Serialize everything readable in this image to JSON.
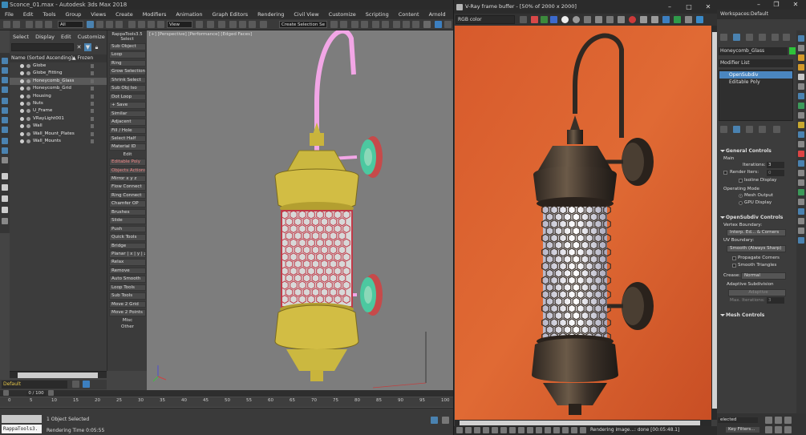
{
  "window": {
    "title": "Sconce_01.max - Autodesk 3ds Max 2018"
  },
  "menu": [
    "File",
    "Edit",
    "Tools",
    "Group",
    "Views",
    "Create",
    "Modifiers",
    "Animation",
    "Graph Editors",
    "Rendering",
    "Civil View",
    "Customize",
    "Scripting",
    "Content",
    "Arnold",
    "Interact"
  ],
  "toolbar": {
    "filter": "All",
    "refcoord": "View",
    "selset": "Create Selection Se"
  },
  "explorer": {
    "tabs": [
      "Select",
      "Display",
      "Edit",
      "Customize"
    ],
    "header_name": "Name (Sorted Ascending)",
    "header_frozen": "▲ Frozen",
    "items": [
      {
        "name": "Globe",
        "selected": false
      },
      {
        "name": "Globe_Fitting",
        "selected": false
      },
      {
        "name": "Honeycomb_Glass",
        "selected": true
      },
      {
        "name": "Honeycomb_Grid",
        "selected": false
      },
      {
        "name": "Housing",
        "selected": false
      },
      {
        "name": "Nuts",
        "selected": false
      },
      {
        "name": "U_Frame",
        "selected": false
      },
      {
        "name": "VRayLight001",
        "selected": false
      },
      {
        "name": "Wall",
        "selected": false
      },
      {
        "name": "Wall_Mount_Plates",
        "selected": false
      },
      {
        "name": "Wall_Mounts",
        "selected": false
      }
    ]
  },
  "layer": {
    "current": "Default"
  },
  "rappatools": {
    "title": "RappaTools3.5",
    "select_label": "Select",
    "edit_label": "Edit",
    "misc_label": "Misc",
    "other_label": "Other",
    "select_buttons": [
      {
        "label": "Sub Object",
        "red": false
      },
      {
        "label": "Loop",
        "red": false
      },
      {
        "label": "Ring",
        "red": false
      },
      {
        "label": "Grow Selection",
        "red": false
      },
      {
        "label": "Shrink Select",
        "red": false
      },
      {
        "label": "Sub Obj Iso",
        "red": false
      },
      {
        "label": "Dot Loop",
        "red": false
      },
      {
        "label": "+ Save",
        "red": false
      },
      {
        "label": "Similar",
        "red": false
      },
      {
        "label": "Adjacent",
        "red": false
      },
      {
        "label": "Fill / Hole",
        "red": false
      },
      {
        "label": "Select Half",
        "red": false
      },
      {
        "label": "Material ID",
        "red": false
      }
    ],
    "edit_buttons": [
      {
        "label": "Editable Poly",
        "red": true
      },
      {
        "label": "Objects Actions",
        "red": true
      },
      {
        "label": "Mirror   x  y  z",
        "red": false
      },
      {
        "label": "Flow Connect",
        "red": false
      },
      {
        "label": "Ring Connect",
        "red": false
      },
      {
        "label": "Chamfer OP",
        "red": false
      },
      {
        "label": "Brushes",
        "red": false
      },
      {
        "label": "Slide",
        "red": false
      },
      {
        "label": "Push",
        "red": false
      },
      {
        "label": "Quick Tools",
        "red": false
      },
      {
        "label": "Bridge",
        "red": false
      },
      {
        "label": "Planar | x | y | z",
        "red": false
      },
      {
        "label": "Relax",
        "red": false
      },
      {
        "label": "Remove",
        "red": false
      },
      {
        "label": "Auto Smooth",
        "red": false
      },
      {
        "label": "Loop Tools",
        "red": false
      },
      {
        "label": "Sub Tools",
        "red": false
      },
      {
        "label": "Move 2 Grid",
        "red": false
      },
      {
        "label": "Move 2 Points",
        "red": false
      }
    ]
  },
  "viewport": {
    "label": "[+] [Perspective] [Performance] [Edged Faces]"
  },
  "timeline": {
    "frame": "0 / 100",
    "ticks": [
      "0",
      "5",
      "10",
      "15",
      "20",
      "25",
      "30",
      "35",
      "40",
      "45",
      "50",
      "55",
      "60",
      "65",
      "70",
      "75",
      "80",
      "85",
      "90",
      "95",
      "100"
    ]
  },
  "status": {
    "maxscript": "RappaTools3.",
    "selection": "1 Object Selected",
    "render_time": "Rendering Time  0:05:55"
  },
  "vfb": {
    "title": "V-Ray frame buffer - [50% of 2000 x 2000]",
    "channel": "RGB color",
    "status": "Rendering image...: done [00:05:48.1]"
  },
  "rightpanel": {
    "workspace_label": "Workspaces:",
    "workspace_value": "Default",
    "object_name": "Honeycomb_Glass",
    "object_color": "#2ec23a",
    "modifier_list": "Modifier List",
    "stack": [
      "OpenSubdiv",
      "Editable Poly"
    ],
    "general_controls": "General Controls",
    "main_label": "Main",
    "iterations_label": "Iterations:",
    "iterations_value": "3",
    "render_iters_label": "Render Iters:",
    "render_iters_value": "0",
    "isoline": "Isoline Display",
    "operating_mode": "Operating Mode",
    "mesh_output": "Mesh Output",
    "gpu_display": "GPU Display",
    "opensubdiv_controls": "OpenSubdiv Controls",
    "vertex_boundary_label": "Vertex Boundary:",
    "vertex_boundary_value": "Interp. Ed... & Corners",
    "uv_boundary_label": "UV Boundary:",
    "uv_boundary_value": "Smooth (Always Sharp)",
    "propagate_corners": "Propagate Corners",
    "smooth_triangles": "Smooth Triangles",
    "crease_label": "Crease:",
    "crease_value": "Normal",
    "adaptive_subdivision": "Adaptive Subdivision",
    "adaptive": "Adaptive",
    "max_iterations_label": "Max. Iterations:",
    "max_iterations_value": "3",
    "mesh_controls": "Mesh Controls",
    "selected_label": "elected",
    "key_filters": "Key Filters..."
  }
}
